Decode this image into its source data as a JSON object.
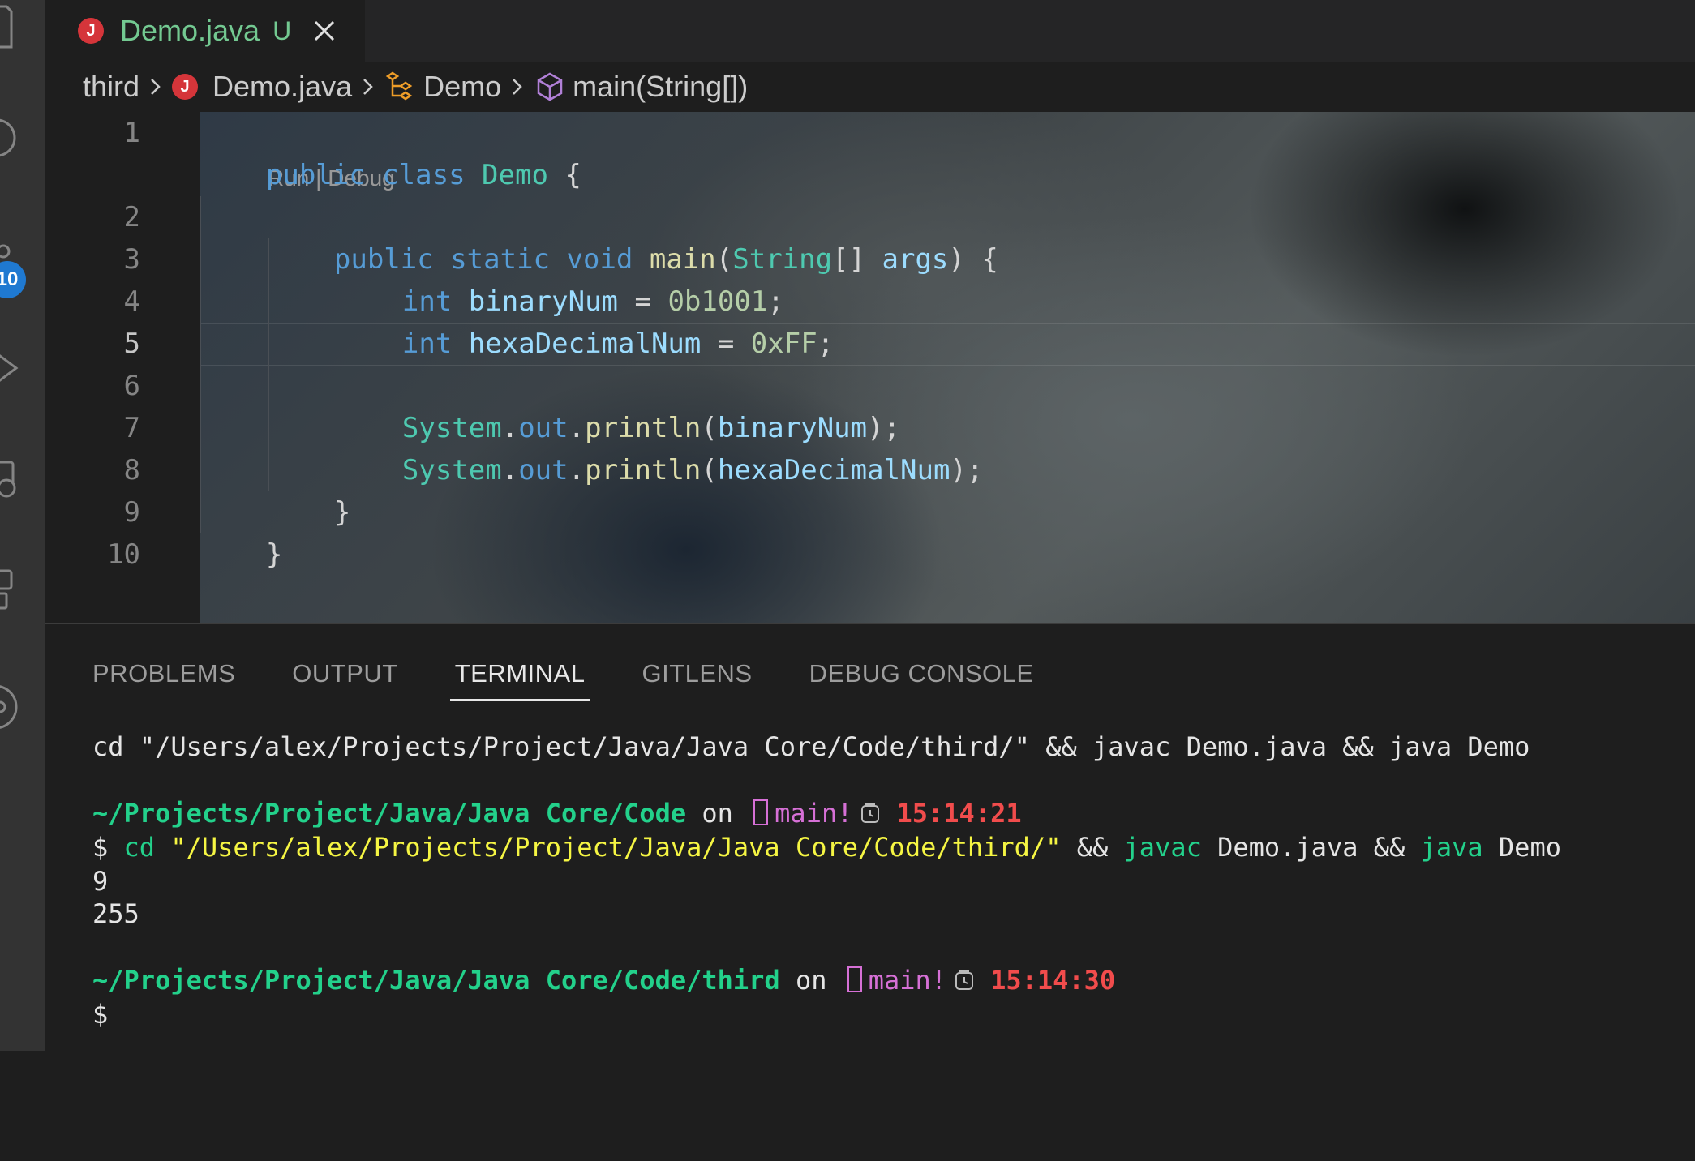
{
  "activity_bar": {
    "badge": "10"
  },
  "tab": {
    "title": "Demo.java",
    "status": "U",
    "icon": "J"
  },
  "breadcrumb": {
    "folder": "third",
    "file": "Demo.java",
    "class": "Demo",
    "method": "main(String[])"
  },
  "editor": {
    "codelens": "Run | Debug",
    "line_numbers": [
      "1",
      "2",
      "3",
      "4",
      "5",
      "6",
      "7",
      "8",
      "9",
      "10"
    ],
    "lines": {
      "l1": {
        "kw1": "public",
        "kw2": "class",
        "name": "Demo",
        "brace": " {"
      },
      "l2": {
        "kw1": "public",
        "kw2": "static",
        "kw3": "void",
        "fn": "main",
        "p1": "(",
        "type": "String",
        "p2": "[] ",
        "arg": "args",
        "p3": ") {"
      },
      "l3": {
        "kw": "int",
        "var": "binaryNum",
        "op": " = ",
        "num": "0b1001",
        "end": ";"
      },
      "l4": {
        "kw": "int",
        "var": "hexaDecimalNum",
        "op": " = ",
        "num": "0xFF",
        "end": ";"
      },
      "l6": {
        "cls": "System",
        "dot1": ".",
        "field": "out",
        "dot2": ".",
        "fn": "println",
        "p1": "(",
        "var": "binaryNum",
        "p2": ");"
      },
      "l7": {
        "cls": "System",
        "dot1": ".",
        "field": "out",
        "dot2": ".",
        "fn": "println",
        "p1": "(",
        "var": "hexaDecimalNum",
        "p2": ");"
      },
      "l8": "}",
      "l9": "}"
    }
  },
  "panel": {
    "tabs": [
      "PROBLEMS",
      "OUTPUT",
      "TERMINAL",
      "GITLENS",
      "DEBUG CONSOLE"
    ],
    "active_tab": "TERMINAL"
  },
  "terminal": {
    "echo_cmd": "cd \"/Users/alex/Projects/Project/Java/Java Core/Code/third/\" && javac Demo.java && java Demo",
    "prompt1": {
      "path": "~/Projects/Project/Java/Java Core/Code",
      "on": " on ",
      "branch": "main!",
      "time": "15:14:21"
    },
    "cmd": {
      "dollar": "$ ",
      "cd": "cd",
      "sp1": " ",
      "str": "\"/Users/alex/Projects/Project/Java/Java Core/Code/third/\"",
      "amp1": " && ",
      "javac": "javac",
      "file": " Demo.java",
      "amp2": " && ",
      "java": "java",
      "cls": " Demo"
    },
    "output": [
      "9",
      "255"
    ],
    "prompt2": {
      "path": "~/Projects/Project/Java/Java Core/Code/third",
      "on": " on ",
      "branch": "main!",
      "time": "15:14:30"
    },
    "final_prompt": "$"
  },
  "colors": {
    "editor_bg": "#1e1e1e",
    "activity_bg": "#333333",
    "badge": "#1f79d1",
    "java_icon": "#d5353a",
    "modified_green": "#73c991",
    "terminal_path": "#23d18b",
    "terminal_branch": "#d670d6",
    "terminal_time": "#f14c4c"
  }
}
